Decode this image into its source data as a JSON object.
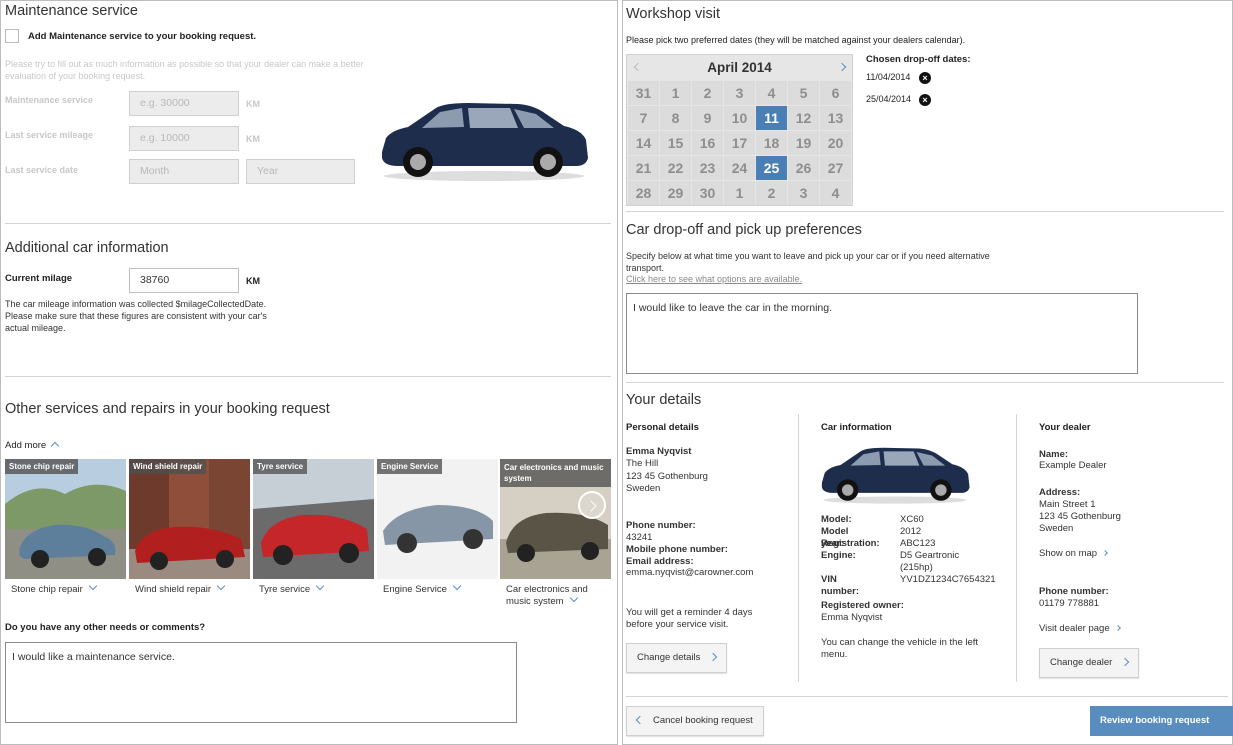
{
  "maintenance": {
    "title": "Maintenance service",
    "checkbox_label": "Add Maintenance service to your booking request.",
    "hint": "Please try to fill out as much information as possible so that your dealer can make a better evaluation of your booking request.",
    "fields": {
      "maintenance_service": {
        "label": "Maintenance service",
        "placeholder": "e.g. 30000",
        "unit": "KM"
      },
      "last_service_mileage": {
        "label": "Last service mileage",
        "placeholder": "e.g. 10000",
        "unit": "KM"
      },
      "last_service_date": {
        "label": "Last service date",
        "month_placeholder": "Month",
        "year_placeholder": "Year"
      }
    }
  },
  "additional": {
    "title": "Additional car information",
    "current_mileage_label": "Current milage",
    "current_mileage_value": "38760",
    "unit": "KM",
    "note": "The car mileage information was collected $milageCollectedDate. Please make sure that these figures are consistent with your car's actual mileage."
  },
  "other_services": {
    "title": "Other services and repairs in your booking request",
    "add_more": "Add more",
    "cards": [
      {
        "tag": "Stone chip repair",
        "label": "Stone chip repair"
      },
      {
        "tag": "Wind shield repair",
        "label": "Wind shield repair"
      },
      {
        "tag": "Tyre service",
        "label": "Tyre service"
      },
      {
        "tag": "Engine Service",
        "label": "Engine Service"
      },
      {
        "tag": "Car electronics and music system",
        "label": "Car electronics and music system"
      }
    ],
    "comments_label": "Do you have any other needs or comments?",
    "comments_value": "I would like a maintenance service."
  },
  "workshop": {
    "title": "Workshop visit",
    "instructions": "Please pick two preferred dates (they will be matched against your dealers calendar).",
    "calendar": {
      "month": "April 2014",
      "weeks": [
        [
          "31",
          "1",
          "2",
          "3",
          "4",
          "5",
          "6"
        ],
        [
          "7",
          "8",
          "9",
          "10",
          "11",
          "12",
          "13"
        ],
        [
          "14",
          "15",
          "16",
          "17",
          "18",
          "19",
          "20"
        ],
        [
          "21",
          "22",
          "23",
          "24",
          "25",
          "26",
          "27"
        ],
        [
          "28",
          "29",
          "30",
          "1",
          "2",
          "3",
          "4"
        ]
      ],
      "selected": [
        "11",
        "25"
      ]
    },
    "chosen_title": "Chosen drop-off dates:",
    "chosen_dates": [
      "11/04/2014",
      "25/04/2014"
    ]
  },
  "dropoff": {
    "title": "Car drop-off and pick up preferences",
    "text": "Specify below at what time you want to leave and pick up your car or if you need alternative transport.",
    "link": "Click here to see what options are available.",
    "value": "I would like to leave the car in the morning."
  },
  "details": {
    "title": "Your details",
    "personal": {
      "heading": "Personal details",
      "name": "Emma Nyqvist",
      "street": "The Hill",
      "city": "123 45 Gothenburg",
      "country": "Sweden",
      "phone_label": "Phone number:",
      "phone": "43241",
      "mobile_label": "Mobile phone number:",
      "email_label": "Email address:",
      "email": "emma.nyqvist@carowner.com",
      "reminder": "You will get a reminder 4 days before your service visit.",
      "change_button": "Change details"
    },
    "car": {
      "heading": "Car information",
      "rows": [
        {
          "k": "Model:",
          "v": "XC60"
        },
        {
          "k": "Model year:",
          "v": "2012"
        },
        {
          "k": "Registration:",
          "v": "ABC123"
        },
        {
          "k": "Engine:",
          "v": "D5 Geartronic"
        },
        {
          "k": "",
          "v": "(215hp)"
        },
        {
          "k": "VIN number:",
          "v": "YV1DZ1234C7654321"
        }
      ],
      "owner_label": "Registered owner:",
      "owner": "Emma Nyqvist",
      "change_note": "You can change the vehicle in the left menu."
    },
    "dealer": {
      "heading": "Your dealer",
      "name_label": "Name:",
      "name": "Example Dealer",
      "address_label": "Address:",
      "street": "Main Street 1",
      "city": "123 45 Gothenburg",
      "country": "Sweden",
      "map_link": "Show on map",
      "phone_label": "Phone number:",
      "phone": "01179 778881",
      "visit_link": "Visit dealer page",
      "change_button": "Change dealer"
    }
  },
  "footer": {
    "cancel": "Cancel booking request",
    "review": "Review booking request"
  },
  "colors": {
    "accent": "#4a7fb5",
    "primary_button": "#5a8dbf"
  }
}
